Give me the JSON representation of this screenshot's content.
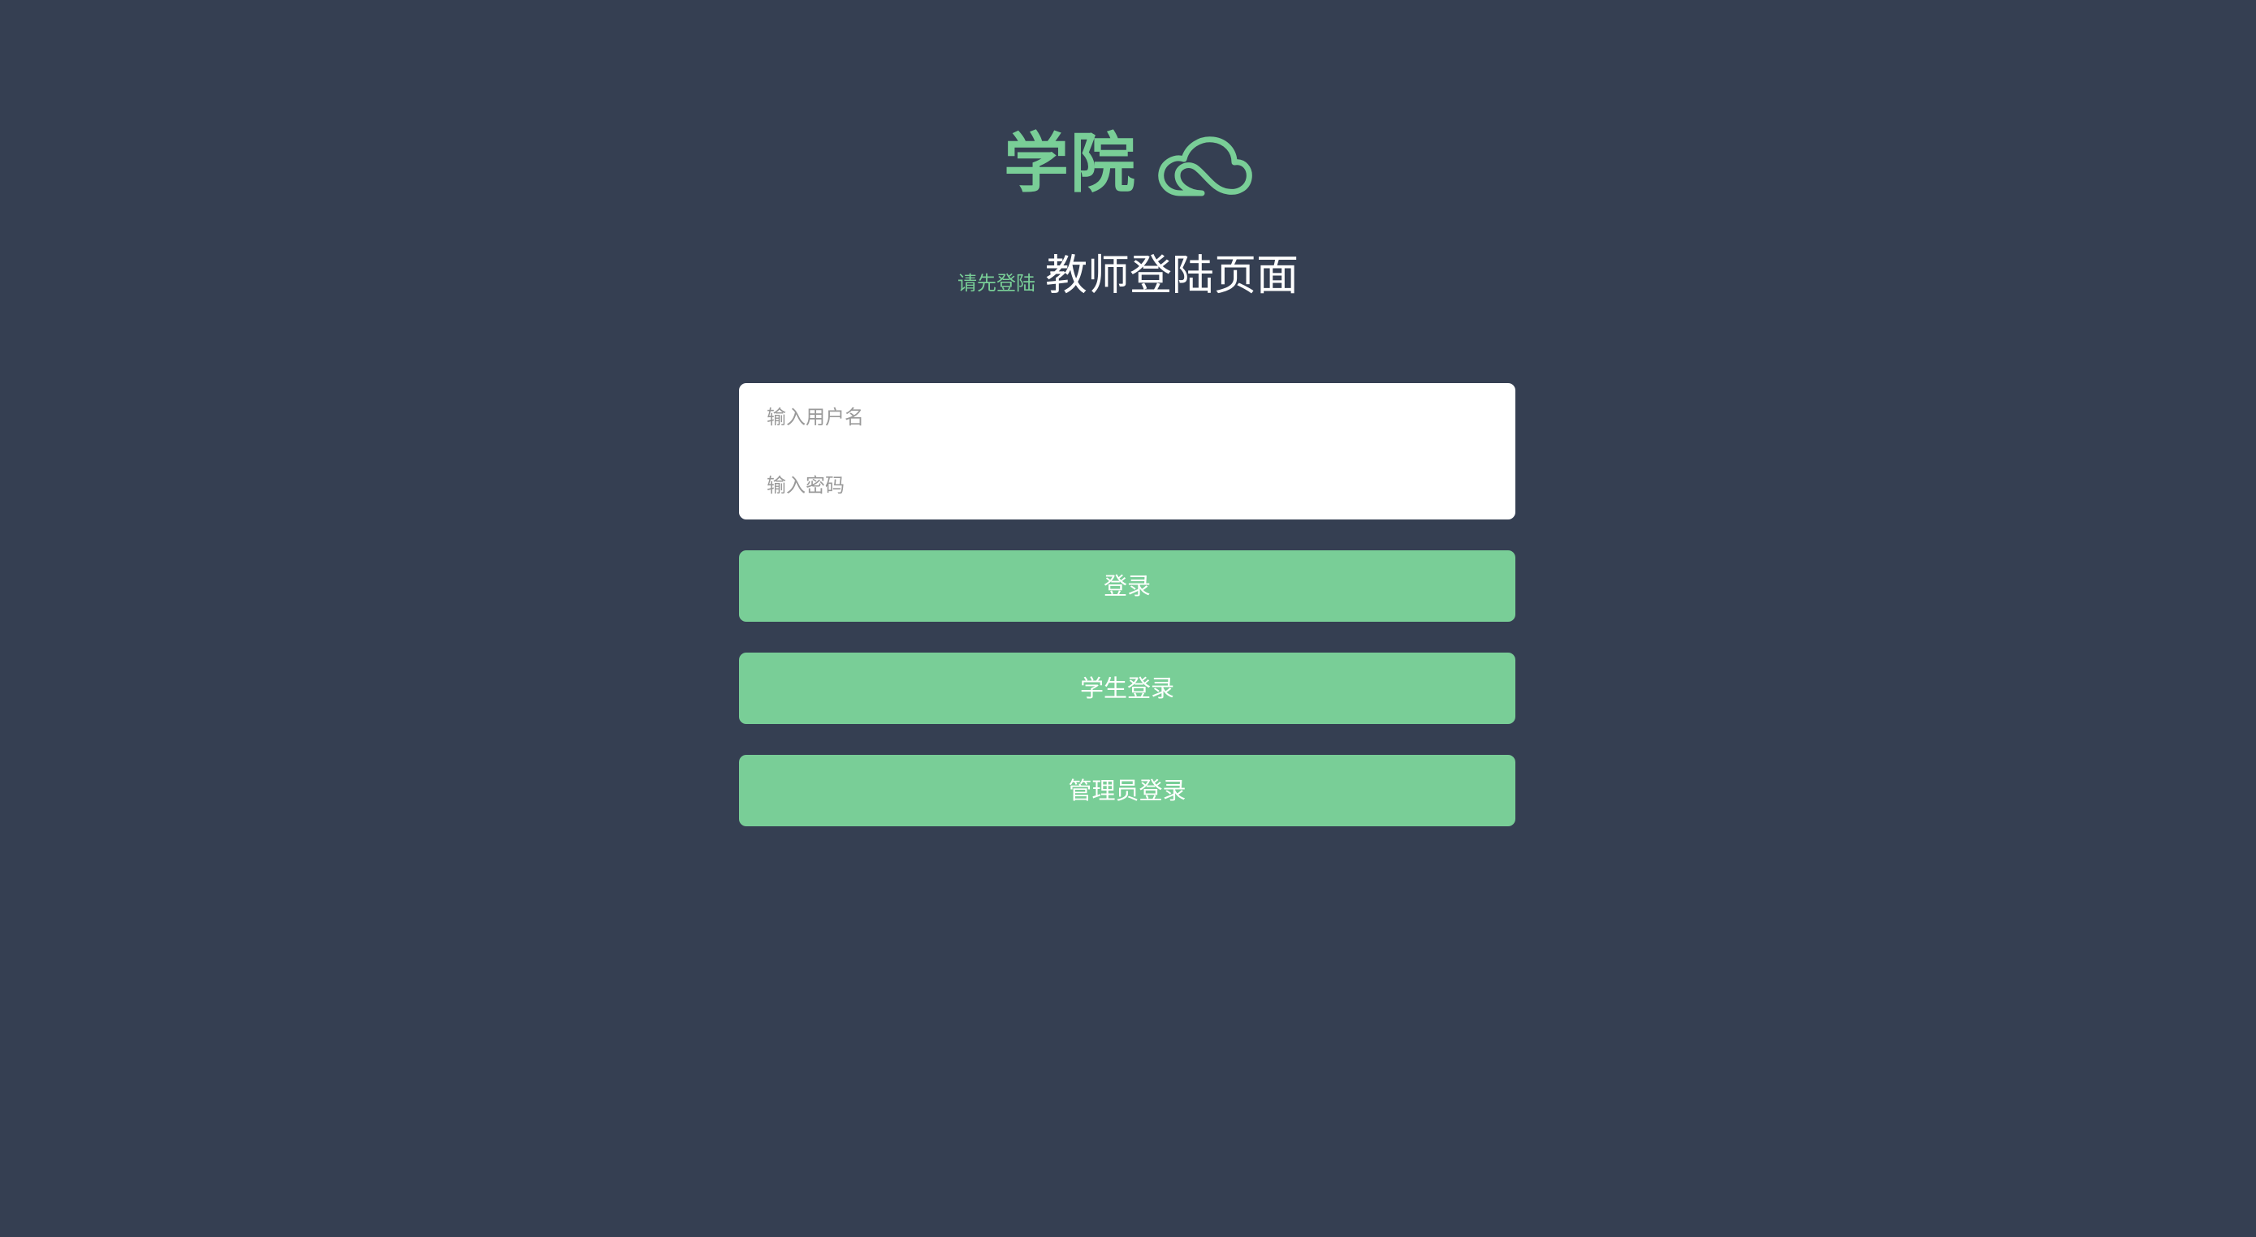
{
  "brand": {
    "title": "学院",
    "icon": "cloud-icon",
    "color": "#79ce97"
  },
  "subtitle": {
    "hint": "请先登陆",
    "main": "教师登陆页面"
  },
  "form": {
    "username_placeholder": "输入用户名",
    "username_value": "",
    "password_placeholder": "输入密码",
    "password_value": ""
  },
  "buttons": {
    "login": "登录",
    "student_login": "学生登录",
    "admin_login": "管理员登录"
  },
  "colors": {
    "background": "#353f52",
    "accent": "#79ce97",
    "card": "#ffffff"
  }
}
